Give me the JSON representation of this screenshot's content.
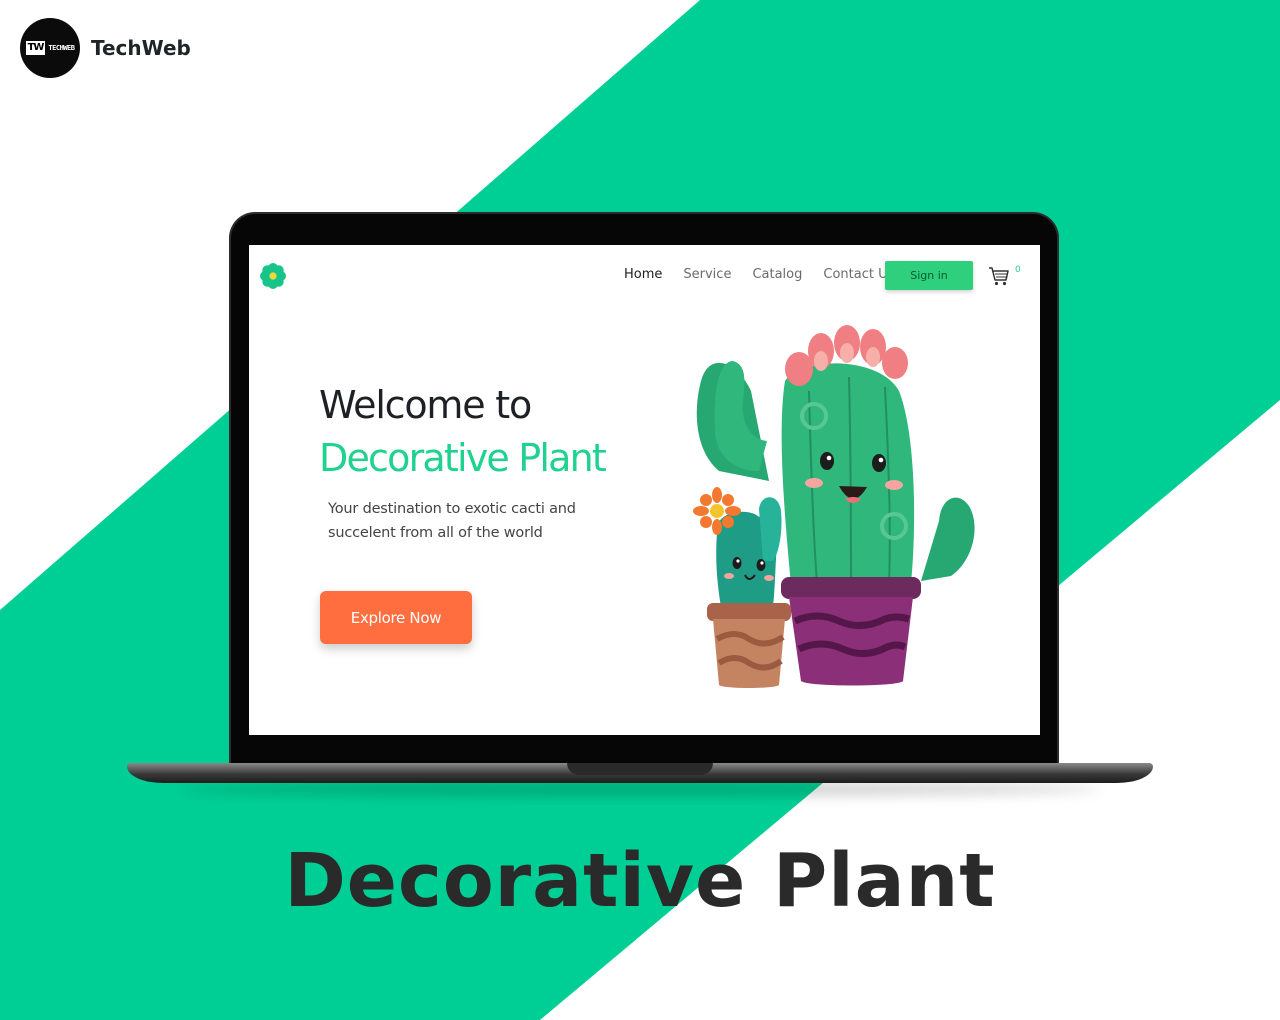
{
  "brand": {
    "name": "TechWeb",
    "logo_mark": "TW",
    "logo_word": "TECHWEB"
  },
  "colors": {
    "accent_green": "#00cf95",
    "button_green": "#2fd07d",
    "headline_green": "#1fd28f",
    "explore_orange": "#ff6e3f",
    "dark_text": "#1d2126"
  },
  "site": {
    "logo_icon": "flower-icon",
    "nav": [
      {
        "label": "Home",
        "active": true
      },
      {
        "label": "Service",
        "active": false
      },
      {
        "label": "Catalog",
        "active": false
      },
      {
        "label": "Contact Us",
        "active": false
      }
    ],
    "signin_label": "Sign in",
    "cart_icon": "cart-icon",
    "cart_count": "0"
  },
  "hero": {
    "title_line1": "Welcome to",
    "title_line2": "Decorative Plant",
    "subtitle": "Your destination to exotic cacti and succelent from all of the world",
    "cta_label": "Explore Now"
  },
  "caption": {
    "title": "Decorative Plant"
  }
}
